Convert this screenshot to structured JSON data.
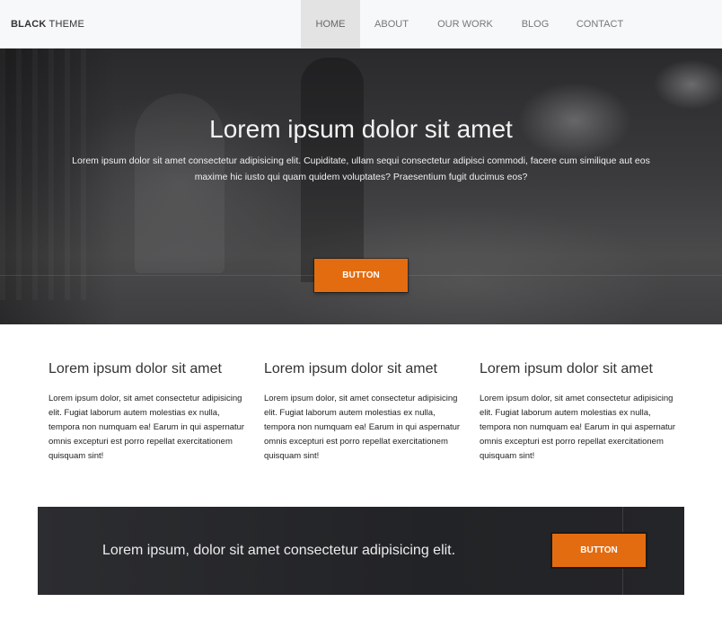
{
  "navbar": {
    "brand_bold": "BLACK",
    "brand_rest": " THEME",
    "items": [
      {
        "label": "HOME"
      },
      {
        "label": "ABOUT"
      },
      {
        "label": "OUR WORK"
      },
      {
        "label": "BLOG"
      },
      {
        "label": "CONTACT"
      }
    ],
    "active_item": "HOME"
  },
  "hero": {
    "title": "Lorem ipsum dolor sit amet",
    "subtitle": "Lorem ipsum dolor sit amet consectetur adipisicing elit. Cupiditate, ullam sequi consectetur adipisci commodi, facere cum similique aut eos maxime hic iusto qui quam quidem voluptates? Praesentium fugit ducimus eos?",
    "button_label": "BUTTON"
  },
  "features": [
    {
      "title": "Lorem ipsum dolor sit amet",
      "text": "Lorem ipsum dolor, sit amet consectetur adipisicing elit. Fugiat laborum autem molestias ex nulla, tempora non numquam ea! Earum in qui aspernatur omnis excepturi est porro repellat exercitationem quisquam sint!"
    },
    {
      "title": "Lorem ipsum dolor sit amet",
      "text": "Lorem ipsum dolor, sit amet consectetur adipisicing elit. Fugiat laborum autem molestias ex nulla, tempora non numquam ea! Earum in qui aspernatur omnis excepturi est porro repellat exercitationem quisquam sint!"
    },
    {
      "title": "Lorem ipsum dolor sit amet",
      "text": "Lorem ipsum dolor, sit amet consectetur adipisicing elit. Fugiat laborum autem molestias ex nulla, tempora non numquam ea! Earum in qui aspernatur omnis excepturi est porro repellat exercitationem quisquam sint!"
    }
  ],
  "cta": {
    "text": "Lorem ipsum, dolor sit amet consectetur adipisicing elit.",
    "button_label": "BUTTON"
  },
  "colors": {
    "accent": "#e36c10",
    "dark_band": "#232427",
    "navbar_bg": "#f7f8fa"
  }
}
